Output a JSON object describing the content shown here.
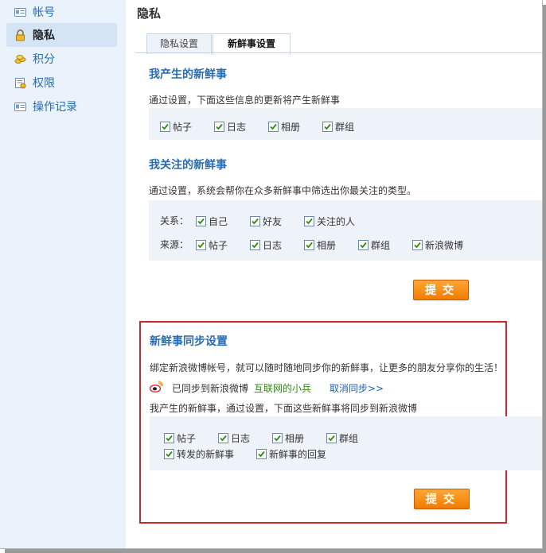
{
  "sidebar": {
    "items": [
      {
        "label": "帐号",
        "icon": "account-card-icon"
      },
      {
        "label": "隐私",
        "icon": "lock-icon",
        "active": true
      },
      {
        "label": "积分",
        "icon": "coins-icon"
      },
      {
        "label": "权限",
        "icon": "permission-icon"
      },
      {
        "label": "操作记录",
        "icon": "log-card-icon"
      }
    ]
  },
  "page": {
    "title": "隐私"
  },
  "tabs": [
    {
      "label": "隐私设置",
      "active": false
    },
    {
      "label": "新鲜事设置",
      "active": true
    }
  ],
  "produce": {
    "title": "我产生的新鲜事",
    "desc": "通过设置，下面这些信息的更新将产生新鲜事",
    "options": [
      {
        "label": "帖子",
        "checked": true
      },
      {
        "label": "日志",
        "checked": true
      },
      {
        "label": "相册",
        "checked": true
      },
      {
        "label": "群组",
        "checked": true
      }
    ]
  },
  "follow": {
    "title": "我关注的新鲜事",
    "desc": "通过设置，系统会帮你在众多新鲜事中筛选出你最关注的类型。",
    "relation_label": "关系：",
    "relation_options": [
      {
        "label": "自己",
        "checked": true
      },
      {
        "label": "好友",
        "checked": true
      },
      {
        "label": "关注的人",
        "checked": true
      }
    ],
    "source_label": "来源：",
    "source_options": [
      {
        "label": "帖子",
        "checked": true
      },
      {
        "label": "日志",
        "checked": true
      },
      {
        "label": "相册",
        "checked": true
      },
      {
        "label": "群组",
        "checked": true
      },
      {
        "label": "新浪微博",
        "checked": true
      }
    ],
    "submit": "提交"
  },
  "sync": {
    "title": "新鲜事同步设置",
    "desc": "绑定新浪微博帐号，就可以随时随地同步你的新鲜事，让更多的朋友分享你的生活！",
    "status_prefix": "已同步到新浪微博",
    "account_name": "互联网的小兵",
    "cancel_link": "取消同步>>",
    "sub_desc": "我产生的新鲜事，通过设置，下面这些新鲜事将同步到新浪微博",
    "options": [
      {
        "label": "帖子",
        "checked": true
      },
      {
        "label": "日志",
        "checked": true
      },
      {
        "label": "相册",
        "checked": true
      },
      {
        "label": "群组",
        "checked": true
      },
      {
        "label": "转发的新鲜事",
        "checked": true
      },
      {
        "label": "新鲜事的回复",
        "checked": true
      }
    ],
    "submit": "提交"
  },
  "colors": {
    "accent": "#2a6cb0",
    "button": "#f07c00",
    "highlight_border": "#cc2a2a"
  }
}
